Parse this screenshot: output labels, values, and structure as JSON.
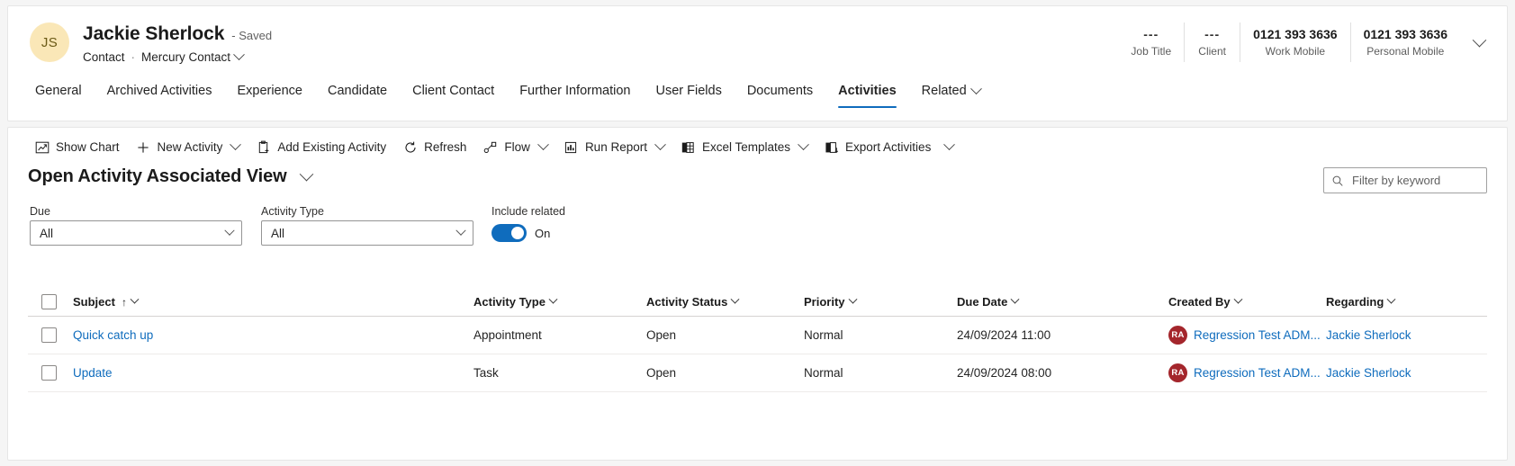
{
  "record": {
    "initials": "JS",
    "name": "Jackie Sherlock",
    "saved_status": "- Saved",
    "entity_type": "Contact",
    "separator": "·",
    "form_name": "Mercury Contact"
  },
  "header_stats": [
    {
      "value": "---",
      "label": "Job Title"
    },
    {
      "value": "---",
      "label": "Client"
    },
    {
      "value": "0121 393 3636",
      "label": "Work Mobile"
    },
    {
      "value": "0121 393 3636",
      "label": "Personal Mobile"
    }
  ],
  "tabs": [
    {
      "label": "General",
      "active": false,
      "caret": false
    },
    {
      "label": "Archived Activities",
      "active": false,
      "caret": false
    },
    {
      "label": "Experience",
      "active": false,
      "caret": false
    },
    {
      "label": "Candidate",
      "active": false,
      "caret": false
    },
    {
      "label": "Client Contact",
      "active": false,
      "caret": false
    },
    {
      "label": "Further Information",
      "active": false,
      "caret": false
    },
    {
      "label": "User Fields",
      "active": false,
      "caret": false
    },
    {
      "label": "Documents",
      "active": false,
      "caret": false
    },
    {
      "label": "Activities",
      "active": true,
      "caret": false
    },
    {
      "label": "Related",
      "active": false,
      "caret": true
    }
  ],
  "commandbar": [
    {
      "label": "Show Chart",
      "icon": "show-chart-icon",
      "caret": false
    },
    {
      "label": "New Activity",
      "icon": "plus-icon",
      "caret": true
    },
    {
      "label": "Add Existing Activity",
      "icon": "add-existing-icon",
      "caret": false
    },
    {
      "label": "Refresh",
      "icon": "refresh-icon",
      "caret": false
    },
    {
      "label": "Flow",
      "icon": "flow-icon",
      "caret": true
    },
    {
      "label": "Run Report",
      "icon": "report-icon",
      "caret": true
    },
    {
      "label": "Excel Templates",
      "icon": "excel-template-icon",
      "caret": true
    },
    {
      "label": "Export Activities",
      "icon": "export-excel-icon",
      "caret": false
    },
    {
      "label": "",
      "icon": "overflow-chevron-icon",
      "caret": true
    }
  ],
  "view": {
    "title": "Open Activity Associated View"
  },
  "search": {
    "placeholder": "Filter by keyword",
    "value": ""
  },
  "filters": {
    "due": {
      "label": "Due",
      "value": "All"
    },
    "activity_type": {
      "label": "Activity Type",
      "value": "All"
    },
    "include_related": {
      "label": "Include related",
      "state": "On"
    }
  },
  "grid": {
    "columns": [
      {
        "key": "subject",
        "label": "Subject",
        "sorted": true,
        "sort_dir": "↑"
      },
      {
        "key": "activity_type",
        "label": "Activity Type",
        "sorted": false
      },
      {
        "key": "activity_status",
        "label": "Activity Status",
        "sorted": false
      },
      {
        "key": "priority",
        "label": "Priority",
        "sorted": false
      },
      {
        "key": "due_date",
        "label": "Due Date",
        "sorted": false
      },
      {
        "key": "created_by",
        "label": "Created By",
        "sorted": false
      },
      {
        "key": "regarding",
        "label": "Regarding",
        "sorted": false
      }
    ],
    "rows": [
      {
        "subject": "Quick catch up",
        "activity_type": "Appointment",
        "activity_status": "Open",
        "priority": "Normal",
        "due_date": "24/09/2024 11:00",
        "created_by": "Regression Test ADM...",
        "created_by_initials": "RA",
        "regarding": "Jackie Sherlock"
      },
      {
        "subject": "Update",
        "activity_type": "Task",
        "activity_status": "Open",
        "priority": "Normal",
        "due_date": "24/09/2024 08:00",
        "created_by": "Regression Test ADM...",
        "created_by_initials": "RA",
        "regarding": "Jackie Sherlock"
      }
    ]
  },
  "colors": {
    "accent": "#0f6cbd",
    "link": "#0f6cbd",
    "persona": "#a4262c",
    "avatar_bg": "#fae7b7"
  }
}
